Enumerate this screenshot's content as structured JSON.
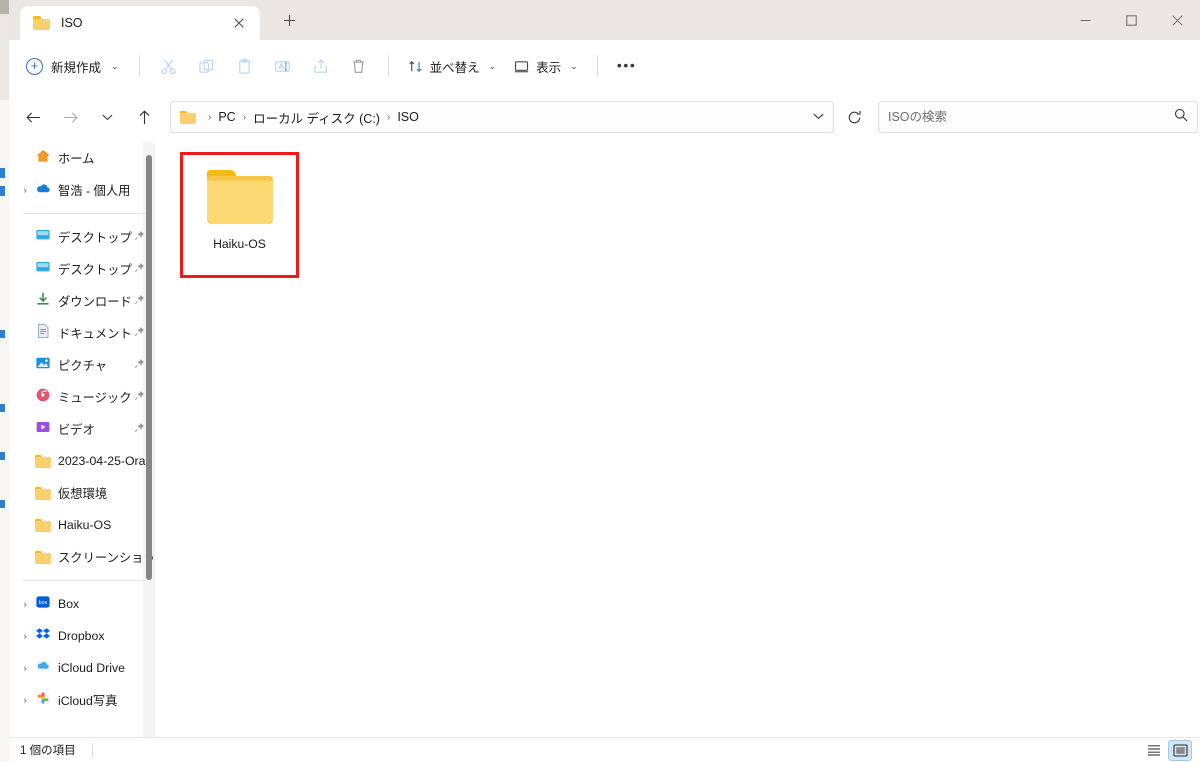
{
  "window": {
    "tab": {
      "title": "ISO",
      "folder_icon": "folder-icon",
      "close_icon": "close-icon"
    },
    "new_tab_icon": "plus-icon",
    "controls": {
      "minimize": "minimize-icon",
      "maximize": "maximize-icon",
      "close": "close-icon"
    }
  },
  "toolbar": {
    "new_label": "新規作成",
    "chevron": "⌄",
    "buttons": [
      {
        "name": "cut-button",
        "icon": "scissors-icon"
      },
      {
        "name": "copy-button",
        "icon": "copy-icon"
      },
      {
        "name": "paste-button",
        "icon": "clipboard-icon"
      },
      {
        "name": "rename-button",
        "icon": "rename-icon"
      },
      {
        "name": "share-button",
        "icon": "share-icon"
      },
      {
        "name": "delete-button",
        "icon": "trash-icon"
      }
    ],
    "sort_label": "並べ替え",
    "view_label": "表示",
    "more_label": "•••"
  },
  "addressbar": {
    "back_icon": "arrow-left-icon",
    "forward_icon": "arrow-right-icon",
    "recent_icon": "chevron-down-icon",
    "up_icon": "arrow-up-icon",
    "refresh_icon": "refresh-icon",
    "folder_icon": "folder-icon",
    "separator": "›",
    "crumbs": [
      "PC",
      "ローカル ディスク (C:)",
      "ISO"
    ],
    "dropdown_icon": "chevron-down-icon"
  },
  "search": {
    "placeholder": "ISOの検索",
    "value": "",
    "icon": "search-icon"
  },
  "sidebar": {
    "groups": [
      {
        "items": [
          {
            "label": "ホーム",
            "icon": "home-icon",
            "expandable": false,
            "pinned": false
          },
          {
            "label": "智浩 - 個人用",
            "icon": "onedrive-icon",
            "expandable": true,
            "pinned": false
          }
        ]
      },
      {
        "items": [
          {
            "label": "デスクトップ",
            "icon": "desktop-icon",
            "expandable": false,
            "pinned": true
          },
          {
            "label": "デスクトップ",
            "icon": "desktop-icon",
            "expandable": false,
            "pinned": true
          },
          {
            "label": "ダウンロード",
            "icon": "download-icon",
            "expandable": false,
            "pinned": true
          },
          {
            "label": "ドキュメント",
            "icon": "document-icon",
            "expandable": false,
            "pinned": true
          },
          {
            "label": "ピクチャ",
            "icon": "pictures-icon",
            "expandable": false,
            "pinned": true
          },
          {
            "label": "ミュージック",
            "icon": "music-icon",
            "expandable": false,
            "pinned": true
          },
          {
            "label": "ビデオ",
            "icon": "video-icon",
            "expandable": false,
            "pinned": true
          },
          {
            "label": "2023-04-25-Ora",
            "icon": "folder-icon",
            "expandable": false,
            "pinned": false
          },
          {
            "label": "仮想環境",
            "icon": "folder-icon",
            "expandable": false,
            "pinned": false
          },
          {
            "label": "Haiku-OS",
            "icon": "folder-icon",
            "expandable": false,
            "pinned": false
          },
          {
            "label": "スクリーンショット",
            "icon": "folder-icon",
            "expandable": false,
            "pinned": false
          }
        ]
      },
      {
        "items": [
          {
            "label": "Box",
            "icon": "box-icon",
            "expandable": true,
            "pinned": false
          },
          {
            "label": "Dropbox",
            "icon": "dropbox-icon",
            "expandable": true,
            "pinned": false
          },
          {
            "label": "iCloud Drive",
            "icon": "icloud-drive-icon",
            "expandable": true,
            "pinned": false
          },
          {
            "label": "iCloud写真",
            "icon": "icloud-photos-icon",
            "expandable": true,
            "pinned": false
          }
        ]
      }
    ],
    "pin_glyph": "📌",
    "expand_glyph": "›",
    "scrollbar": "sidebar-scrollbar"
  },
  "content": {
    "items": [
      {
        "label": "Haiku-OS",
        "icon": "folder-icon",
        "selected": true,
        "annotated": true
      }
    ],
    "annotation_color": "#ee1b1b"
  },
  "statusbar": {
    "item_count": "1 個の項目",
    "views": [
      {
        "name": "list-view-button",
        "icon": "list-view-icon",
        "active": false
      },
      {
        "name": "details-view-button",
        "icon": "large-icons-view-icon",
        "active": true
      }
    ]
  }
}
